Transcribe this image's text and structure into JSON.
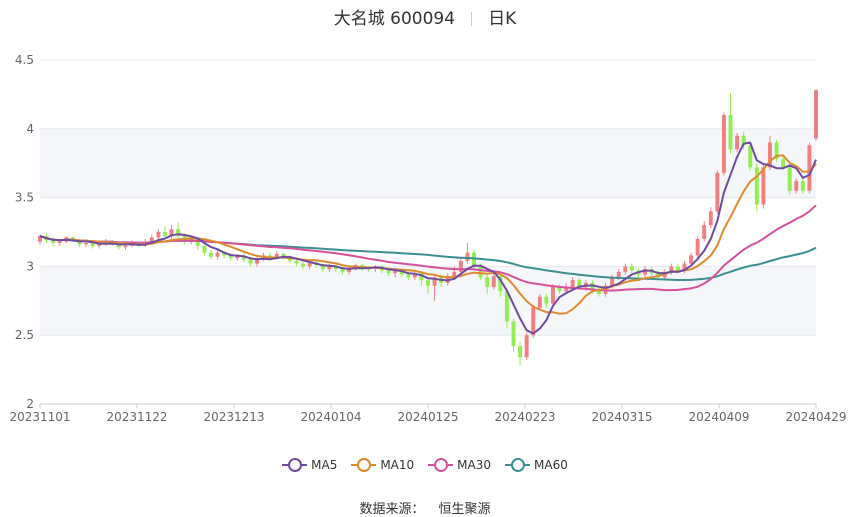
{
  "header": {
    "stock_name": "大名城 600094",
    "period": "日K"
  },
  "source": {
    "label": "数据来源：",
    "provider": "恒生聚源"
  },
  "colors": {
    "up": "#f08080",
    "down": "#90ee50",
    "ma5": "#6f4ba0",
    "ma10": "#e08a2c",
    "ma30": "#d6509a",
    "ma60": "#3a8f8f",
    "grid": "#e5e8ef",
    "band": "#f5f6fa"
  },
  "chart_data": {
    "type": "candlestick",
    "y_axis": {
      "min": 2,
      "max": 4.5,
      "ticks": [
        "2",
        "2.5",
        "3",
        "3.5",
        "4",
        "4.5"
      ]
    },
    "x_axis": {
      "labels": [
        "20231101",
        "20231122",
        "20231213",
        "20240104",
        "20240125",
        "20240223",
        "20240315",
        "20240409",
        "20240429"
      ]
    },
    "legend": [
      "MA5",
      "MA10",
      "MA30",
      "MA60"
    ],
    "candles": [
      [
        3.18,
        3.22,
        3.16,
        3.23
      ],
      [
        3.22,
        3.19,
        3.17,
        3.24
      ],
      [
        3.19,
        3.17,
        3.15,
        3.21
      ],
      [
        3.17,
        3.18,
        3.15,
        3.2
      ],
      [
        3.18,
        3.21,
        3.17,
        3.22
      ],
      [
        3.21,
        3.19,
        3.18,
        3.22
      ],
      [
        3.19,
        3.16,
        3.14,
        3.2
      ],
      [
        3.16,
        3.17,
        3.14,
        3.19
      ],
      [
        3.17,
        3.15,
        3.13,
        3.18
      ],
      [
        3.15,
        3.16,
        3.13,
        3.18
      ],
      [
        3.16,
        3.18,
        3.15,
        3.2
      ],
      [
        3.18,
        3.17,
        3.15,
        3.19
      ],
      [
        3.17,
        3.14,
        3.12,
        3.18
      ],
      [
        3.14,
        3.15,
        3.12,
        3.17
      ],
      [
        3.15,
        3.17,
        3.14,
        3.19
      ],
      [
        3.17,
        3.15,
        3.14,
        3.18
      ],
      [
        3.15,
        3.18,
        3.14,
        3.2
      ],
      [
        3.18,
        3.21,
        3.17,
        3.23
      ],
      [
        3.21,
        3.25,
        3.2,
        3.27
      ],
      [
        3.25,
        3.22,
        3.2,
        3.29
      ],
      [
        3.22,
        3.27,
        3.2,
        3.3
      ],
      [
        3.27,
        3.22,
        3.2,
        3.32
      ],
      [
        3.22,
        3.18,
        3.16,
        3.24
      ],
      [
        3.18,
        3.2,
        3.16,
        3.22
      ],
      [
        3.2,
        3.15,
        3.12,
        3.21
      ],
      [
        3.15,
        3.1,
        3.08,
        3.16
      ],
      [
        3.1,
        3.07,
        3.05,
        3.12
      ],
      [
        3.07,
        3.1,
        3.05,
        3.12
      ],
      [
        3.1,
        3.08,
        3.06,
        3.11
      ],
      [
        3.08,
        3.06,
        3.04,
        3.1
      ],
      [
        3.06,
        3.08,
        3.04,
        3.09
      ],
      [
        3.08,
        3.05,
        3.03,
        3.1
      ],
      [
        3.05,
        3.02,
        3.0,
        3.07
      ],
      [
        3.02,
        3.05,
        3.0,
        3.07
      ],
      [
        3.05,
        3.08,
        3.04,
        3.1
      ],
      [
        3.08,
        3.06,
        3.04,
        3.1
      ],
      [
        3.06,
        3.09,
        3.05,
        3.11
      ],
      [
        3.09,
        3.07,
        3.05,
        3.1
      ],
      [
        3.07,
        3.04,
        3.02,
        3.08
      ],
      [
        3.04,
        3.02,
        3.0,
        3.06
      ],
      [
        3.02,
        3.0,
        2.98,
        3.04
      ],
      [
        3.0,
        3.03,
        2.98,
        3.05
      ],
      [
        3.03,
        3.01,
        2.99,
        3.04
      ],
      [
        3.01,
        2.98,
        2.96,
        3.02
      ],
      [
        2.98,
        3.0,
        2.96,
        3.02
      ],
      [
        3.0,
        2.98,
        2.96,
        3.01
      ],
      [
        2.98,
        2.96,
        2.94,
        3.0
      ],
      [
        2.96,
        2.99,
        2.94,
        3.0
      ],
      [
        2.99,
        3.01,
        2.97,
        3.02
      ],
      [
        3.01,
        2.99,
        2.97,
        3.02
      ],
      [
        2.99,
        2.98,
        2.96,
        3.0
      ],
      [
        2.98,
        3.0,
        2.96,
        3.01
      ],
      [
        3.0,
        2.97,
        2.95,
        3.01
      ],
      [
        2.97,
        2.95,
        2.93,
        2.98
      ],
      [
        2.95,
        2.97,
        2.92,
        2.99
      ],
      [
        2.97,
        2.94,
        2.92,
        2.98
      ],
      [
        2.94,
        2.92,
        2.9,
        2.96
      ],
      [
        2.92,
        2.95,
        2.9,
        2.97
      ],
      [
        2.95,
        2.9,
        2.86,
        2.96
      ],
      [
        2.9,
        2.86,
        2.8,
        2.92
      ],
      [
        2.86,
        2.92,
        2.75,
        2.93
      ],
      [
        2.92,
        2.88,
        2.85,
        2.94
      ],
      [
        2.88,
        2.93,
        2.86,
        2.95
      ],
      [
        2.93,
        2.96,
        2.9,
        3.0
      ],
      [
        2.96,
        3.04,
        2.94,
        3.06
      ],
      [
        3.04,
        3.1,
        3.02,
        3.17
      ],
      [
        3.1,
        3.0,
        2.97,
        3.12
      ],
      [
        3.0,
        2.92,
        2.9,
        3.02
      ],
      [
        2.92,
        2.85,
        2.8,
        2.94
      ],
      [
        2.85,
        2.93,
        2.83,
        2.95
      ],
      [
        2.93,
        2.82,
        2.78,
        2.94
      ],
      [
        2.82,
        2.6,
        2.55,
        2.84
      ],
      [
        2.6,
        2.42,
        2.38,
        2.62
      ],
      [
        2.42,
        2.34,
        2.28,
        2.45
      ],
      [
        2.34,
        2.5,
        2.32,
        2.52
      ],
      [
        2.5,
        2.7,
        2.48,
        2.72
      ],
      [
        2.7,
        2.78,
        2.68,
        2.8
      ],
      [
        2.78,
        2.73,
        2.7,
        2.8
      ],
      [
        2.73,
        2.85,
        2.72,
        2.87
      ],
      [
        2.85,
        2.82,
        2.8,
        2.87
      ],
      [
        2.82,
        2.85,
        2.8,
        2.88
      ],
      [
        2.85,
        2.9,
        2.83,
        2.92
      ],
      [
        2.9,
        2.85,
        2.83,
        2.92
      ],
      [
        2.85,
        2.88,
        2.82,
        2.9
      ],
      [
        2.88,
        2.83,
        2.8,
        2.9
      ],
      [
        2.83,
        2.8,
        2.78,
        2.86
      ],
      [
        2.8,
        2.86,
        2.78,
        2.88
      ],
      [
        2.86,
        2.92,
        2.84,
        2.94
      ],
      [
        2.92,
        2.96,
        2.9,
        2.98
      ],
      [
        2.96,
        3.0,
        2.94,
        3.02
      ],
      [
        3.0,
        2.97,
        2.95,
        3.02
      ],
      [
        2.97,
        2.94,
        2.92,
        2.99
      ],
      [
        2.94,
        2.98,
        2.92,
        3.0
      ],
      [
        2.98,
        2.95,
        2.93,
        3.0
      ],
      [
        2.95,
        2.92,
        2.9,
        2.97
      ],
      [
        2.92,
        2.96,
        2.9,
        2.98
      ],
      [
        2.96,
        3.0,
        2.94,
        3.02
      ],
      [
        3.0,
        2.97,
        2.95,
        3.02
      ],
      [
        2.97,
        3.02,
        2.95,
        3.04
      ],
      [
        3.02,
        3.08,
        3.0,
        3.1
      ],
      [
        3.08,
        3.2,
        3.06,
        3.22
      ],
      [
        3.2,
        3.3,
        3.18,
        3.33
      ],
      [
        3.3,
        3.4,
        3.28,
        3.43
      ],
      [
        3.4,
        3.68,
        3.38,
        3.7
      ],
      [
        3.68,
        4.1,
        3.66,
        4.12
      ],
      [
        4.1,
        3.85,
        3.82,
        4.26
      ],
      [
        3.85,
        3.95,
        3.83,
        3.97
      ],
      [
        3.95,
        3.88,
        3.85,
        3.98
      ],
      [
        3.88,
        3.72,
        3.7,
        3.9
      ],
      [
        3.72,
        3.45,
        3.4,
        3.75
      ],
      [
        3.45,
        3.72,
        3.42,
        3.74
      ],
      [
        3.72,
        3.9,
        3.7,
        3.95
      ],
      [
        3.9,
        3.78,
        3.76,
        3.92
      ],
      [
        3.78,
        3.72,
        3.7,
        3.8
      ],
      [
        3.72,
        3.55,
        3.52,
        3.74
      ],
      [
        3.55,
        3.62,
        3.53,
        3.64
      ],
      [
        3.62,
        3.55,
        3.53,
        3.64
      ],
      [
        3.55,
        3.88,
        3.53,
        3.9
      ],
      [
        3.93,
        4.28,
        3.91,
        4.29
      ]
    ]
  }
}
